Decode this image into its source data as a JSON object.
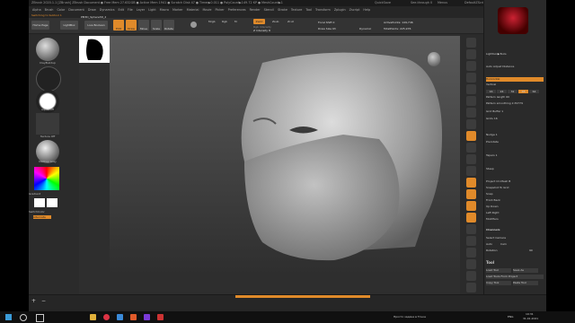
{
  "titlebar": {
    "text": "ZBrush 2020.1.1 [ZBrush]   ZBrush Document   ● Free Mem 27.632GB ● Active Mem 1941 ● Scratch Disk 47 ● Timer▶0.011 ● PolyCount▶149.72 KP ● MeshCount▶1",
    "quicksave": "QuickSave",
    "see_through": "See-through 0",
    "menus": "Menus",
    "default_script": "DefaultZScript"
  },
  "menubar": [
    "Alpha",
    "Brush",
    "Color",
    "Document",
    "Draw",
    "Dynamics",
    "Edit",
    "File",
    "Layer",
    "Light",
    "Macro",
    "Marker",
    "Material",
    "Movie",
    "Picker",
    "Preferences",
    "Render",
    "Stencil",
    "Stroke",
    "Texture",
    "Tool",
    "Transform",
    "Zplugin",
    "Zscript",
    "Help"
  ],
  "note": "Switching to Subtool 1",
  "shelf": {
    "home_page": "Home Page",
    "lightbox": "LightBox",
    "live_boolean": "Live Boolean",
    "edit": "Edit",
    "draw": "Draw",
    "move": "Move",
    "scale": "Scale",
    "rotate": "Rotate",
    "mrgb": "Mrgb",
    "rgb": "Rgb",
    "m": "M",
    "zadd": "Zadd",
    "zsub": "Zsub",
    "zcut": "Zcut",
    "rgb_intensity": "Rgb Intensity",
    "z_intensity": "Z Intensity 8",
    "focal_shift": "Focal Shift 0",
    "draw_size": "Draw Size 93",
    "dynamic": "Dynamic",
    "active_points": "ActivePoints: 149,746",
    "total_points": "TotalPoints: 225,976",
    "subtool_name": "PM3D_Sphere3D_2"
  },
  "left": {
    "brush": "ClayBuildup",
    "stroke": "FreeHand",
    "alpha": "Alpha Off",
    "texture": "Texture Off",
    "material": "MatCap Gray",
    "gradient": "Gradient",
    "switch_color": "SwitchColor",
    "alternate": "Alternate"
  },
  "panel": {
    "tool_label": "Lightbox▶Tools",
    "auto_adjust": "Auto Adjust Distance",
    "horizontal": "Horizontal",
    "vertical": "Vertical",
    "nums": [
      "16",
      "24",
      "32",
      "48",
      "64"
    ],
    "pattern_len": "Pattern length 60",
    "pattern_smooth": "Pattern smoothing 2.39779",
    "grid_buffer": "Grid Buffer 1",
    "grids": "Grids 16",
    "nudge": "Nudge 1",
    "prerotate": "Prerotate",
    "taperz": "Tapers 1",
    "steep": "Steep",
    "project_mesh": "Project On Mesh B",
    "snapshot": "Snapshot To Grid",
    "snap": "Snap",
    "front_back": "Front Back",
    "up_down": "Up Down",
    "left_right": "Left Right",
    "modifiers": "Modifiers",
    "channels": "Channels",
    "select_camera": "Select Camera",
    "auto_cam": "Auto",
    "cam": "Cam",
    "rotation": "Rotation",
    "rot_val": "90",
    "tool_section": "Tool",
    "load_tool": "Load Tool",
    "save_as": "Save As",
    "load_tools_from": "Load Tools From Project",
    "copy_tool": "Copy Tool",
    "paste_tool": "Paste Tool"
  },
  "bottom": {
    "plus": "+",
    "minus": "−"
  },
  "taskbar": {
    "lang": "ENG",
    "time": "19:31",
    "date": "31.01.2021",
    "status": "Просто задача в Точке"
  }
}
